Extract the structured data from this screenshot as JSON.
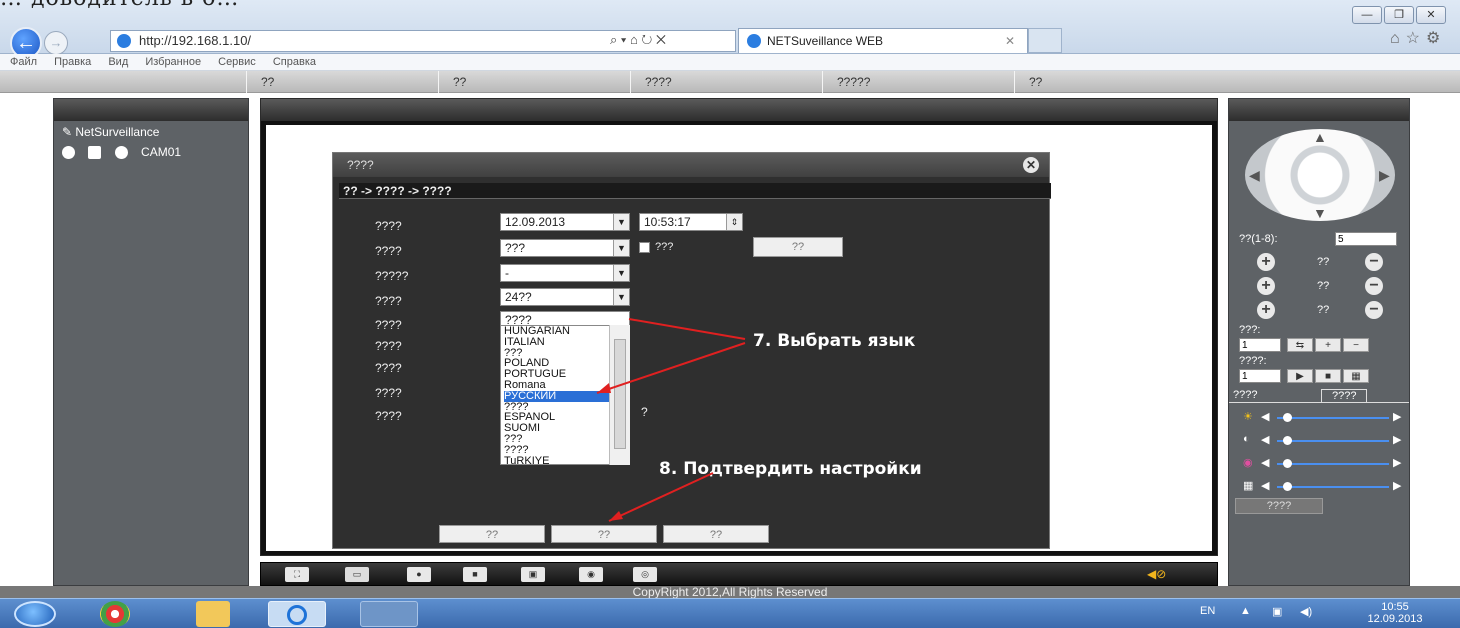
{
  "header_caption": "… доводитель в о…",
  "browser": {
    "url": "http://192.168.1.10/",
    "url_host": "192.168.1.10",
    "address_tools": "⌕ ▾ ⌂ ↻ ✕",
    "tab_title": "NETSuveillance WEB",
    "tab_close": "✕",
    "window_buttons": [
      "—",
      "❐",
      "✕"
    ],
    "menu": [
      "Файл",
      "Правка",
      "Вид",
      "Избранное",
      "Сервис",
      "Справка"
    ]
  },
  "top_nav": [
    "??",
    "??",
    "????",
    "?????",
    "??"
  ],
  "left_panel": {
    "title": "NetSurveillance",
    "camera": "CAM01"
  },
  "dialog": {
    "title": "????",
    "breadcrumb": "?? -> ???? -> ????",
    "rows": [
      {
        "label": "????",
        "value": "12.09.2013",
        "extra": "10:53:17"
      },
      {
        "label": "????",
        "value": "???",
        "checkbox_label": "???",
        "button": "??"
      },
      {
        "label": "?????",
        "value": "-"
      },
      {
        "label": "????",
        "value": "24??"
      },
      {
        "label": "????",
        "value": "????"
      },
      {
        "label": "????"
      },
      {
        "label": "????"
      },
      {
        "label": "????"
      },
      {
        "label": "????",
        "trailing": "?"
      }
    ],
    "language_options": [
      "HUNGARIAN",
      "ITALIAN",
      "???",
      "POLAND",
      "PORTUGUE",
      "Romana",
      "РУССКИЙ",
      "????",
      "ESPANOL",
      "SUOMI",
      "???",
      "????",
      "TuRKIYE"
    ],
    "selected_language": "РУССКИЙ",
    "buttons": [
      "??",
      "??",
      "??"
    ]
  },
  "annotations": {
    "step7": "7. Выбрать язык",
    "step8": "8. Подтвердить настройки"
  },
  "right_panel": {
    "preset_label": "??(1-8):",
    "preset_value": "5",
    "rows": [
      "??",
      "??",
      "??"
    ],
    "cruise_label": "???:",
    "cruise_value": "1",
    "pattern_label": "????:",
    "pattern_value": "1",
    "tabs": [
      "????",
      "????"
    ],
    "default_button": "????"
  },
  "footer": {
    "copyright": "CopyRight 2012,All Rights Reserved"
  },
  "taskbar": {
    "lang": "EN",
    "time": "10:55",
    "date": "12.09.2013"
  },
  "colors": {
    "dialog_bg": "#2f2f2f",
    "selection": "#2a6fd6",
    "annotation_arrow": "#e02020",
    "taskbar": "#3b6aad"
  }
}
